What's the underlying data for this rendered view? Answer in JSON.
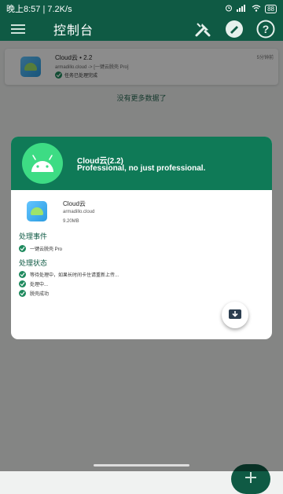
{
  "status_bar": {
    "left_text": "晚上8:57 | 7.2K/s",
    "icons": [
      "alarm-icon",
      "signal-icon",
      "wifi-icon"
    ],
    "battery": "88"
  },
  "app_bar": {
    "title": "控制台",
    "icons": [
      "menu-icon",
      "tools-icon",
      "brush-icon",
      "help-icon"
    ]
  },
  "task_card": {
    "name": "Cloud云 • 2.2",
    "subtitle": "armadillo.cloud -> [一键云脱壳 Pro]",
    "status": "任务已处理完成",
    "time": "5分钟前"
  },
  "list_end_text": "没有更多数据了",
  "dialog": {
    "title": "Cloud云(2.2)",
    "subtitle": "Professional, no just professional.",
    "app_name": "Cloud云",
    "package": "armadillo.cloud",
    "size": "9.20MB",
    "section_events": "处理事件",
    "events": [
      "一键云脱壳 Pro"
    ],
    "section_status": "处理状态",
    "statuses": [
      "等待处理中，如果长时间卡住请重新上传...",
      "处理中...",
      "脱壳成功"
    ],
    "download_icon": "download-box-icon"
  },
  "fab": {
    "icon": "plus-icon"
  },
  "colors": {
    "primary": "#0f5a44",
    "header": "#0f7a57",
    "android": "#3ddc84"
  }
}
